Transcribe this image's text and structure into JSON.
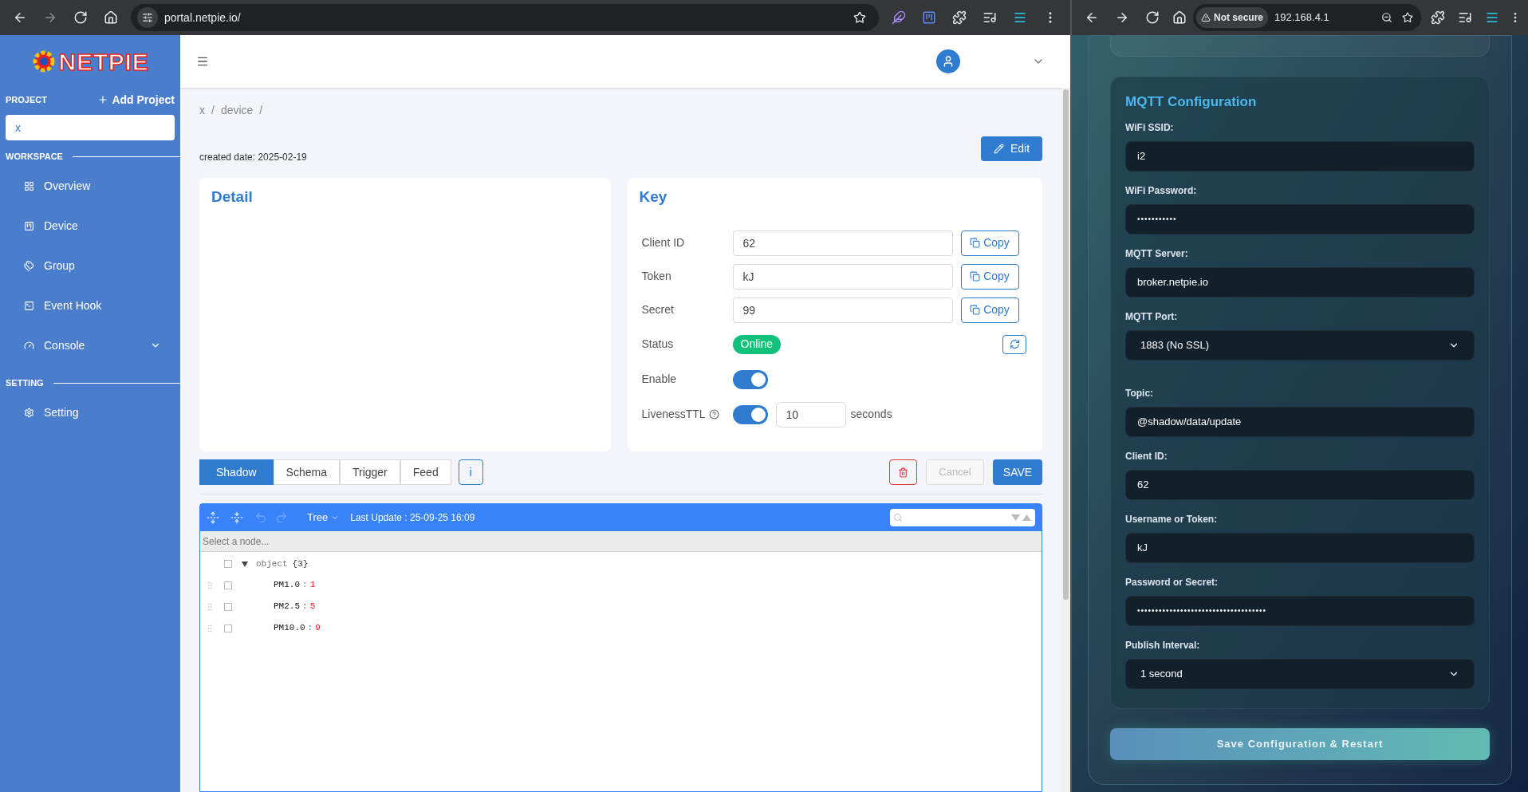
{
  "left_browser": {
    "url": "portal.netpie.io/"
  },
  "sidebar": {
    "logo": "NETPIE",
    "project_label": "PROJECT",
    "add_project": "Add Project",
    "project_value": "x",
    "sections": [
      {
        "title": "WORKSPACE",
        "items": [
          {
            "label": "Overview",
            "has_submenu": false
          },
          {
            "label": "Device",
            "has_submenu": false
          },
          {
            "label": "Group",
            "has_submenu": false
          },
          {
            "label": "Event Hook",
            "has_submenu": false
          },
          {
            "label": "Console",
            "has_submenu": true
          }
        ]
      },
      {
        "title": "SETTING",
        "items": [
          {
            "label": "Setting",
            "has_submenu": false
          }
        ]
      }
    ]
  },
  "breadcrumb": [
    "x",
    "/",
    "device",
    "/"
  ],
  "created_date": "created date: 2025-02-19",
  "edit_button": "Edit",
  "detail": {
    "title": "Detail"
  },
  "key": {
    "title": "Key",
    "rows": [
      {
        "kind": "field",
        "label": "Client ID",
        "value": "62",
        "button": "Copy"
      },
      {
        "kind": "field",
        "label": "Token",
        "value": "kJ",
        "button": "Copy"
      },
      {
        "kind": "field",
        "label": "Secret",
        "value": "99",
        "button": "Copy"
      },
      {
        "kind": "status",
        "label": "Status",
        "badge": "Online"
      },
      {
        "kind": "toggle",
        "label": "Enable",
        "on": true
      },
      {
        "kind": "ttl",
        "label": "LivenessTTL",
        "on": true,
        "value": "10",
        "unit": "seconds"
      }
    ]
  },
  "tabs": [
    {
      "label": "Shadow",
      "selected": true
    },
    {
      "label": "Schema",
      "selected": false
    },
    {
      "label": "Trigger",
      "selected": false
    },
    {
      "label": "Feed",
      "selected": false
    }
  ],
  "info_button": "i",
  "actions": {
    "cancel": "Cancel",
    "cancel_disabled": true,
    "save": "SAVE"
  },
  "editor": {
    "mode": "Tree",
    "last_update": "Last Update : 25-09-25 16:09",
    "nav_placeholder": "Select a node...",
    "root": {
      "key": "object",
      "count": "{3}",
      "expanded": true,
      "children": [
        {
          "key": "PM1.0",
          "separator": ":",
          "value": "1"
        },
        {
          "key": "PM2.5",
          "separator": ":",
          "value": "5"
        },
        {
          "key": "PM10.0",
          "separator": ":",
          "value": "9"
        }
      ]
    }
  },
  "right_browser": {
    "security": "Not secure",
    "url": "192.168.4.1"
  },
  "mqtt": {
    "title": "MQTT Configuration",
    "fields": [
      {
        "kind": "text",
        "label": "WiFi SSID:",
        "value": "i2"
      },
      {
        "kind": "password",
        "label": "WiFi Password:",
        "value": "•••••••••••"
      },
      {
        "kind": "text",
        "label": "MQTT Server:",
        "value": "broker.netpie.io"
      },
      {
        "kind": "select",
        "label": "MQTT Port:",
        "value": "1883 (No SSL)"
      },
      {
        "kind": "text",
        "label": "Topic:",
        "value": "@shadow/data/update"
      },
      {
        "kind": "text",
        "label": "Client ID:",
        "value": "62"
      },
      {
        "kind": "text",
        "label": "Username or Token:",
        "value": "kJ"
      },
      {
        "kind": "password",
        "label": "Password or Secret:",
        "value": "••••••••••••••••••••••••••••••••••••"
      },
      {
        "kind": "select",
        "label": "Publish Interval:",
        "value": "1 second"
      }
    ],
    "save_button": "Save Configuration & Restart"
  }
}
